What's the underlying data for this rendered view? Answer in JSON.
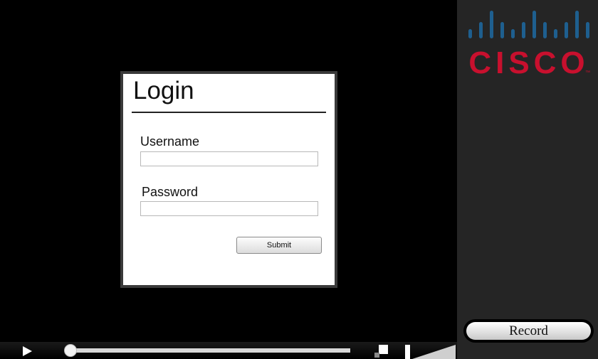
{
  "login": {
    "title": "Login",
    "username_label": "Username",
    "username_value": "",
    "password_label": "Password",
    "password_value": "",
    "submit_label": "Submit"
  },
  "player": {
    "play_icon": "play-icon",
    "progress": 0,
    "fullscreen_icon": "fullscreen-icon",
    "volume_icon": "volume-icon"
  },
  "side_panel": {
    "logo_text": "CISCO",
    "logo_trademark": "™",
    "record_label": "Record"
  },
  "colors": {
    "background": "#000000",
    "panel": "#252525",
    "cisco_blue": "#1e5f8f",
    "cisco_red": "#c8102e"
  }
}
